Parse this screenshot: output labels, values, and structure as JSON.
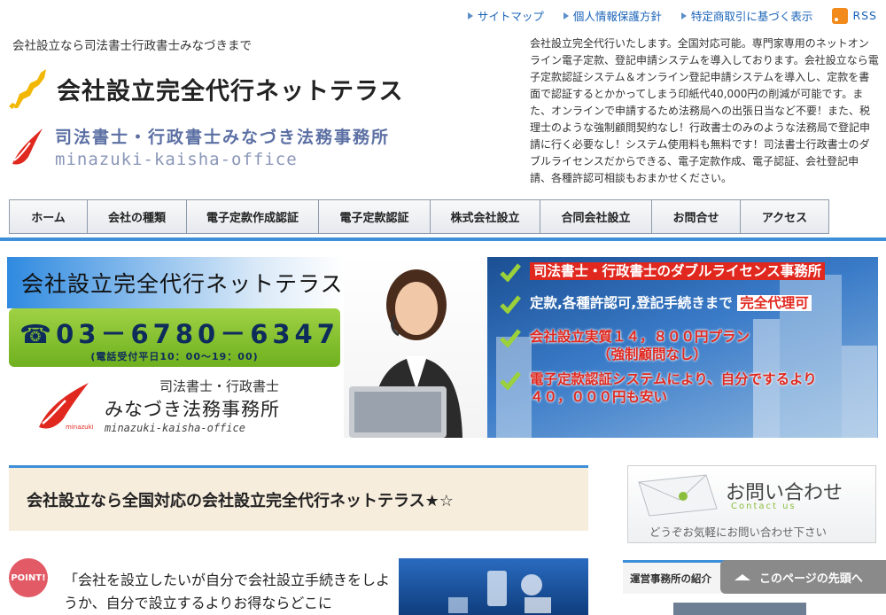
{
  "toplinks": [
    {
      "label": "サイトマップ"
    },
    {
      "label": "個人情報保護方針"
    },
    {
      "label": "特定商取引に基づく表示"
    }
  ],
  "rss": {
    "label": "RSS",
    "icon": "rss-icon"
  },
  "header": {
    "tagline": "会社設立なら司法書士行政書士みなづきまで",
    "site_title": "会社設立完全代行ネットテラス",
    "office_name": "司法書士・行政書士みなづき法務事務所",
    "office_roman": "minazuki-kaisha-office",
    "intro": "会社設立完全代行いたします。全国対応可能。専門家専用のネットオンライン電子定款、登記申請システムを導入しております。会社設立なら電子定款認証システム＆オンライン登記申請システムを導入し、定款を書面で認証するとかかってしまう印紙代40,000円の削減が可能です。また、オンラインで申請するため法務局への出張日当など不要！また、税理士のような強制顧問契約なし！行政書士のみのような法務局で登記申請に行く必要なし！システム使用料も無料です！司法書士行政書士のダブルライセンスだからできる、電子定款作成、電子認証、会社登記申請、各種許認可相談もおまかせください。"
  },
  "nav": [
    {
      "label": "ホーム"
    },
    {
      "label": "会社の種類"
    },
    {
      "label": "電子定款作成認証"
    },
    {
      "label": "電子定款認証"
    },
    {
      "label": "株式会社設立"
    },
    {
      "label": "合同会社設立"
    },
    {
      "label": "お問合せ"
    },
    {
      "label": "アクセス"
    }
  ],
  "hero": {
    "title": "会社設立完全代行ネットテラス",
    "phone": "☎03－6780－6347",
    "hours": "(電話受付平日10：00～19：00)",
    "logo_line1": "司法書士・行政書士",
    "logo_line2": "みなづき法務事務所",
    "logo_roman": "minazuki-kaisha-office",
    "logo_mark_text": "minazuki",
    "points": [
      {
        "text": "司法書士・行政書士のダブルライセンス事務所",
        "color": "#ffffff",
        "bg": "#e0281f"
      },
      {
        "text": "定款,各種許認可,登記手続きまで",
        "em": "完全代理可",
        "color": "#ffffff",
        "em_color": "#e0281f",
        "em_bg": "#ffffff"
      },
      {
        "text": "会社設立実質１４，８００円プラン",
        "line2": "（強制顧問なし）",
        "color": "#e0281f"
      },
      {
        "text": "電子定款認証システムにより、自分でするより",
        "line2": "４０，０００円も安い",
        "color": "#e0281f"
      }
    ]
  },
  "section": {
    "title": "会社設立なら全国対応の会社設立完全代行ネットテラス★☆",
    "point_badge": "POINT!",
    "quote": "「会社を設立したいが自分で会社設立手続きをしようか、自分で設立するよりお得ならどこに"
  },
  "contact": {
    "title": "お問い合わせ",
    "subtitle": "Contact us",
    "note": "どうぞお気軽にお問い合わせ下さい"
  },
  "sidebar": {
    "heading": "運営事務所の紹介"
  },
  "backtop": {
    "label": "このページの先頭へ"
  },
  "colors": {
    "accent": "#3d8fd9",
    "link": "#1a63b8",
    "green": "#8bbd3c",
    "red": "#e0281f"
  }
}
